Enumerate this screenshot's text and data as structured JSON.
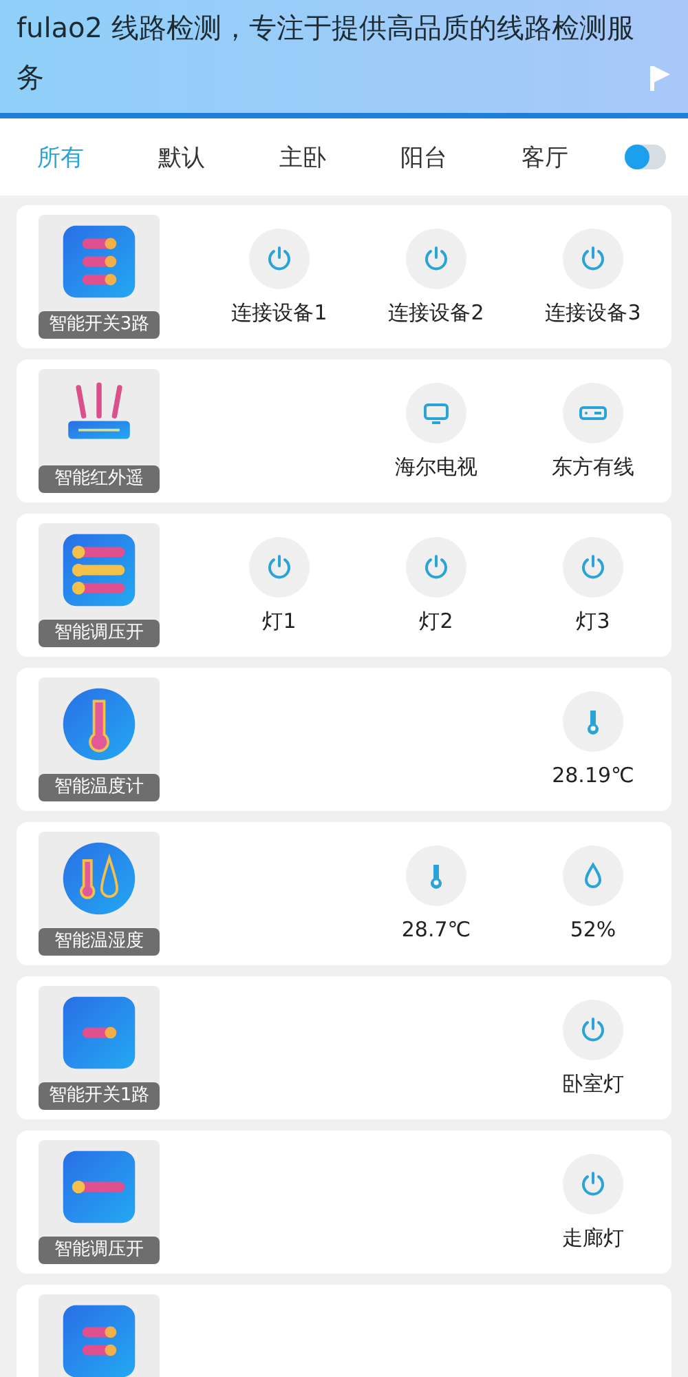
{
  "caption": "fulao2 线路检测，专注于提供高品质的线路检测服务",
  "tabs": [
    {
      "label": "所有",
      "selected": true
    },
    {
      "label": "默认",
      "selected": false
    },
    {
      "label": "主卧",
      "selected": false
    },
    {
      "label": "阳台",
      "selected": false
    },
    {
      "label": "客厅",
      "selected": false
    }
  ],
  "devices": [
    {
      "kind": "switch3",
      "name": "智能开关3路",
      "actions": [
        {
          "kind": "power",
          "label": "连接设备1"
        },
        {
          "kind": "power",
          "label": "连接设备2"
        },
        {
          "kind": "power",
          "label": "连接设备3"
        }
      ]
    },
    {
      "kind": "ir",
      "name": "智能红外遥",
      "actions": [
        {
          "kind": "tv",
          "label": "海尔电视"
        },
        {
          "kind": "settop",
          "label": "东方有线"
        }
      ]
    },
    {
      "kind": "dimmer3",
      "name": "智能调压开",
      "actions": [
        {
          "kind": "power",
          "label": "灯1"
        },
        {
          "kind": "power",
          "label": "灯2"
        },
        {
          "kind": "power",
          "label": "灯3"
        }
      ]
    },
    {
      "kind": "thermo",
      "name": "智能温度计",
      "actions": [
        {
          "kind": "thermo",
          "label": "28.19℃"
        }
      ]
    },
    {
      "kind": "thermohygro",
      "name": "智能温湿度",
      "actions": [
        {
          "kind": "thermo",
          "label": "28.7℃"
        },
        {
          "kind": "drop",
          "label": "52%"
        }
      ]
    },
    {
      "kind": "switch1",
      "name": "智能开关1路",
      "actions": [
        {
          "kind": "power",
          "label": "卧室灯"
        }
      ]
    },
    {
      "kind": "dimmer1",
      "name": "智能调压开",
      "actions": [
        {
          "kind": "power",
          "label": "走廊灯"
        }
      ]
    },
    {
      "kind": "switch2"
    }
  ]
}
